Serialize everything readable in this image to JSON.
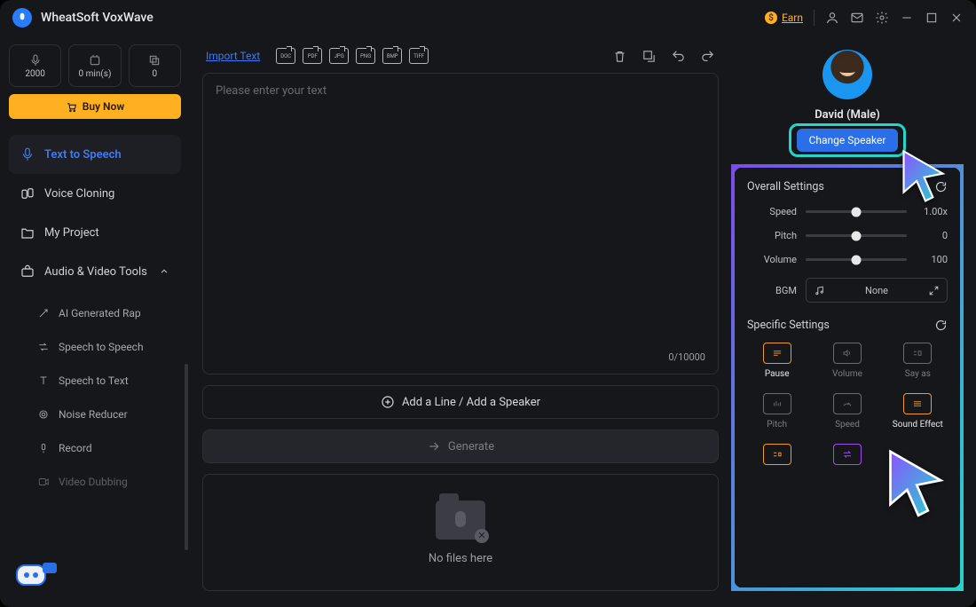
{
  "title": "WheatSoft VoxWave",
  "earn_label": "Earn",
  "quota": {
    "chars": "2000",
    "minutes": "0 min(s)",
    "count": "0"
  },
  "buy_now": "Buy Now",
  "nav": {
    "tts": "Text to Speech",
    "cloning": "Voice Cloning",
    "project": "My Project",
    "tools": "Audio & Video Tools"
  },
  "tools_sub": {
    "rap": "AI Generated Rap",
    "s2s": "Speech to Speech",
    "s2t": "Speech to Text",
    "noise": "Noise Reducer",
    "record": "Record",
    "dub": "Video Dubbing"
  },
  "editor": {
    "import": "Import Text",
    "formats": {
      "doc": "DOC",
      "pdf": "PDF",
      "jpg": "JPG",
      "png": "PNG",
      "bmp": "BMP",
      "tiff": "TIFF"
    },
    "placeholder": "Please enter your text",
    "counter": "0/10000",
    "add_line": "Add a Line / Add a Speaker",
    "generate": "Generate",
    "no_files": "No files here"
  },
  "speaker": {
    "name": "David (Male)",
    "change": "Change Speaker"
  },
  "settings": {
    "overall_title": "Overall Settings",
    "speed": {
      "label": "Speed",
      "value": "1.00x",
      "pos": 50
    },
    "pitch": {
      "label": "Pitch",
      "value": "0",
      "pos": 50
    },
    "volume": {
      "label": "Volume",
      "value": "100",
      "pos": 50
    },
    "bgm": {
      "label": "BGM",
      "value": "None"
    },
    "specific_title": "Specific Settings",
    "items": {
      "pause": "Pause",
      "volume2": "Volume",
      "sayas": "Say as",
      "pitch2": "Pitch",
      "speed2": "Speed",
      "sfx": "Sound Effect"
    }
  }
}
